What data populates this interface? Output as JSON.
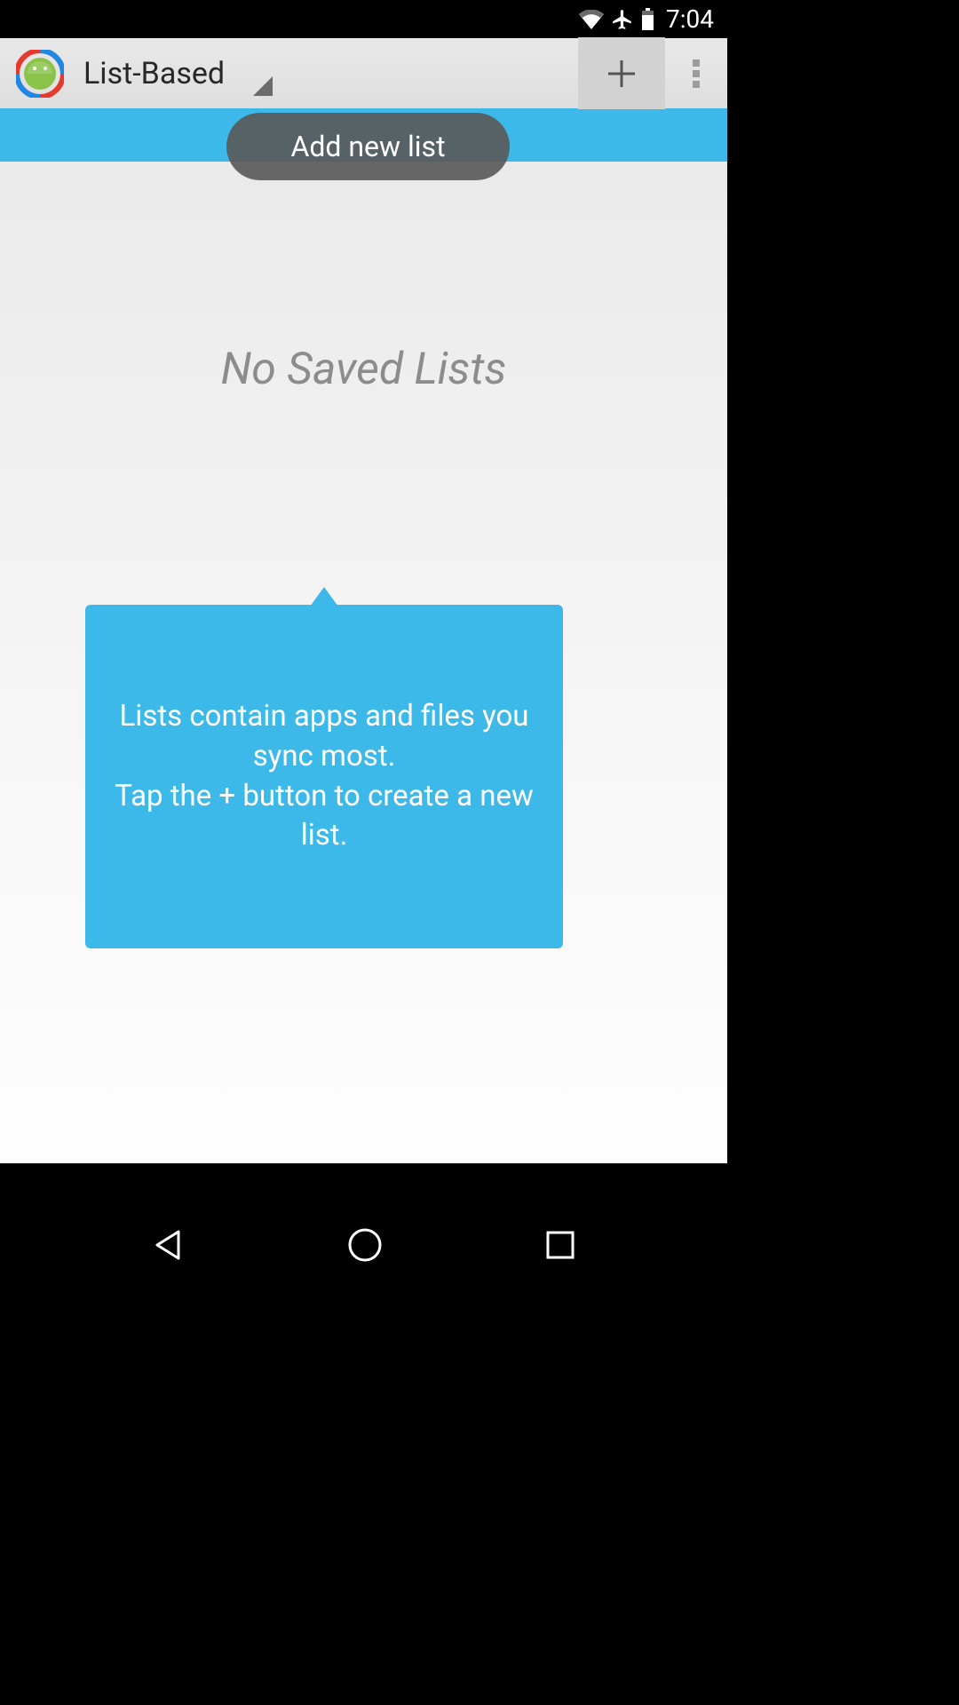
{
  "status": {
    "time": "7:04"
  },
  "appbar": {
    "title": "List-Based"
  },
  "tooltip": {
    "label": "Add new list"
  },
  "empty": {
    "heading": "No Saved Lists",
    "hint": "Lists contain apps and files you sync most.\nTap the + button to create a new list."
  }
}
